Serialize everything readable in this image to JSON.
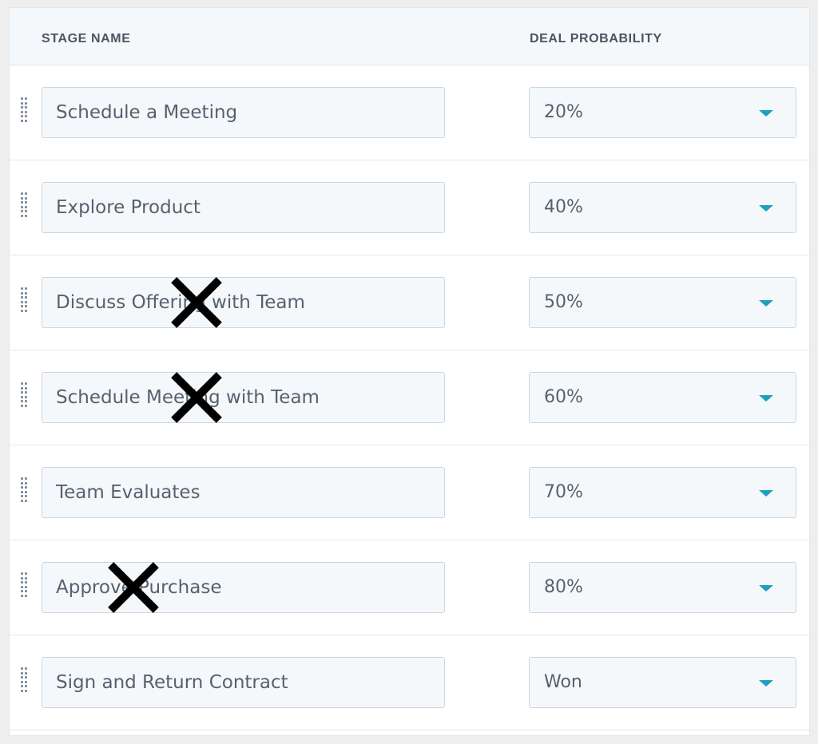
{
  "table": {
    "columns": {
      "stage_name": "STAGE NAME",
      "deal_probability": "DEAL PROBABILITY"
    },
    "rows": [
      {
        "stage_name": "Schedule a Meeting",
        "deal_probability": "20%",
        "crossed_out": false
      },
      {
        "stage_name": "Explore Product",
        "deal_probability": "40%",
        "crossed_out": false
      },
      {
        "stage_name": "Discuss Offering with Team",
        "deal_probability": "50%",
        "crossed_out": true
      },
      {
        "stage_name": "Schedule Meeting with Team",
        "deal_probability": "60%",
        "crossed_out": true
      },
      {
        "stage_name": "Team Evaluates",
        "deal_probability": "70%",
        "crossed_out": false
      },
      {
        "stage_name": "Approve Purchase",
        "deal_probability": "80%",
        "crossed_out": true
      },
      {
        "stage_name": "Sign and Return Contract",
        "deal_probability": "Won",
        "crossed_out": false
      }
    ]
  },
  "icons": {
    "drag_handle": "drag-handle-icon",
    "dropdown_caret": "caret-down-icon",
    "cross_mark": "x-mark-icon"
  },
  "colors": {
    "accent_caret": "#1aa2bd",
    "input_background": "#f5f8fa",
    "input_border": "#cbd6e2",
    "header_background": "#f5f8fa",
    "text": "#56616d",
    "cross_mark": "#000000"
  }
}
